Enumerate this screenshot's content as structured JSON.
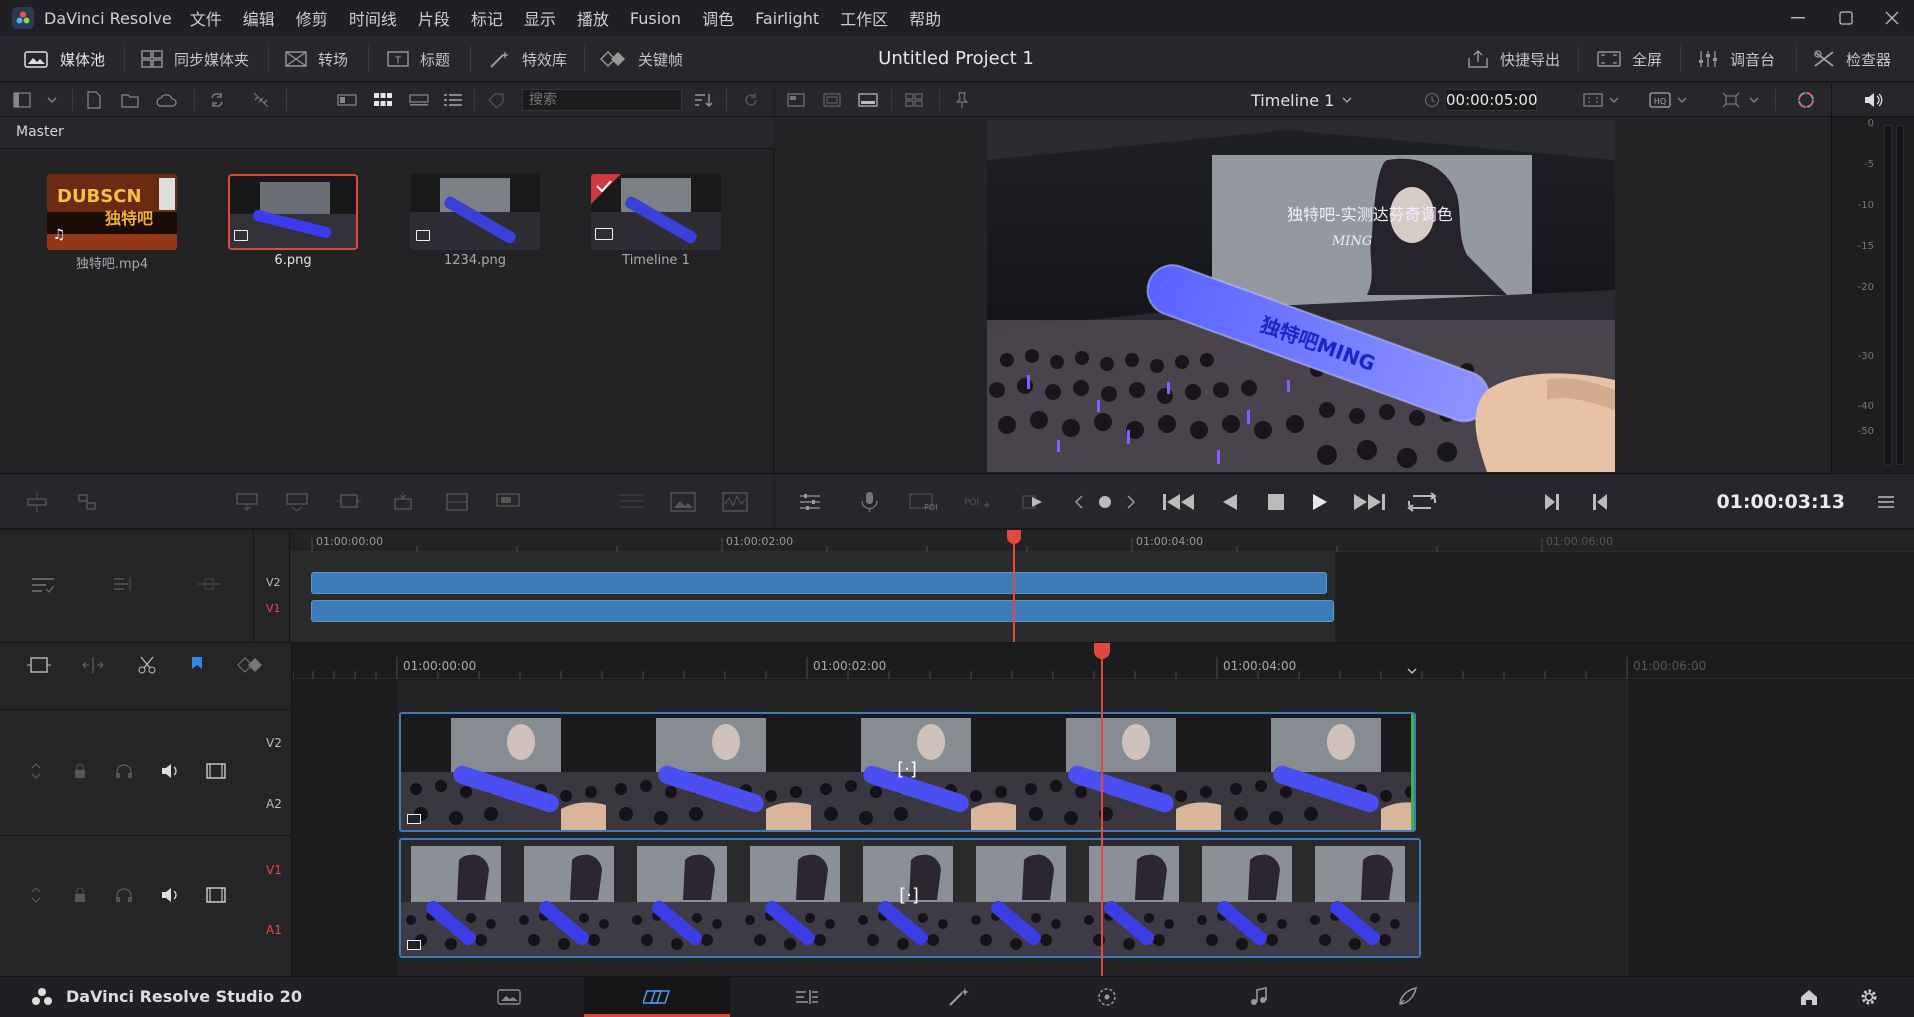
{
  "app": {
    "name": "DaVinci Resolve",
    "project_title": "Untitled Project 1",
    "studio_label": "DaVinci Resolve Studio 20"
  },
  "menu": [
    "文件",
    "编辑",
    "修剪",
    "时间线",
    "片段",
    "标记",
    "显示",
    "播放",
    "Fusion",
    "调色",
    "Fairlight",
    "工作区",
    "帮助"
  ],
  "toolbar": {
    "media_pool": "媒体池",
    "sync_bin": "同步媒体夹",
    "transitions": "转场",
    "titles": "标题",
    "effects": "特效库",
    "keyframes": "关键帧",
    "quick_export": "快捷导出",
    "fullscreen": "全屏",
    "mixer": "调音台",
    "inspector": "检查器"
  },
  "media": {
    "search_placeholder": "搜索",
    "bin": "Master",
    "items": [
      {
        "name": "独特吧.mp4",
        "type": "audio-video"
      },
      {
        "name": "6.png",
        "type": "image",
        "selected": true
      },
      {
        "name": "1234.png",
        "type": "image"
      },
      {
        "name": "Timeline 1",
        "type": "timeline"
      }
    ]
  },
  "viewer": {
    "timeline_name": "Timeline 1",
    "duration": "00:00:05:00",
    "timecode": "01:00:03:13",
    "image_caption": "独特吧-实测达芬奇调色",
    "image_sub": "MING",
    "stick_text": "独特吧MING"
  },
  "meter": {
    "scale": [
      "0",
      "-5",
      "-10",
      "-15",
      "-20",
      "-30",
      "-40",
      "-50"
    ]
  },
  "upper_timeline": {
    "ruler": [
      "01:00:00:00",
      "01:00:02:00",
      "01:00:04:00",
      "01:00:06:00"
    ],
    "tracks": [
      "V2",
      "V1"
    ]
  },
  "main_timeline": {
    "ruler": [
      "01:00:00:00",
      "01:00:02:00",
      "01:00:04:00",
      "01:00:06:00"
    ],
    "track_upper": [
      "V2",
      "A2"
    ],
    "track_lower": [
      "V1",
      "A1"
    ]
  },
  "colors": {
    "accent": "#d0393f",
    "clip": "#3d7cb8",
    "selection": "#e0493c",
    "playhead": "#e0493c"
  }
}
